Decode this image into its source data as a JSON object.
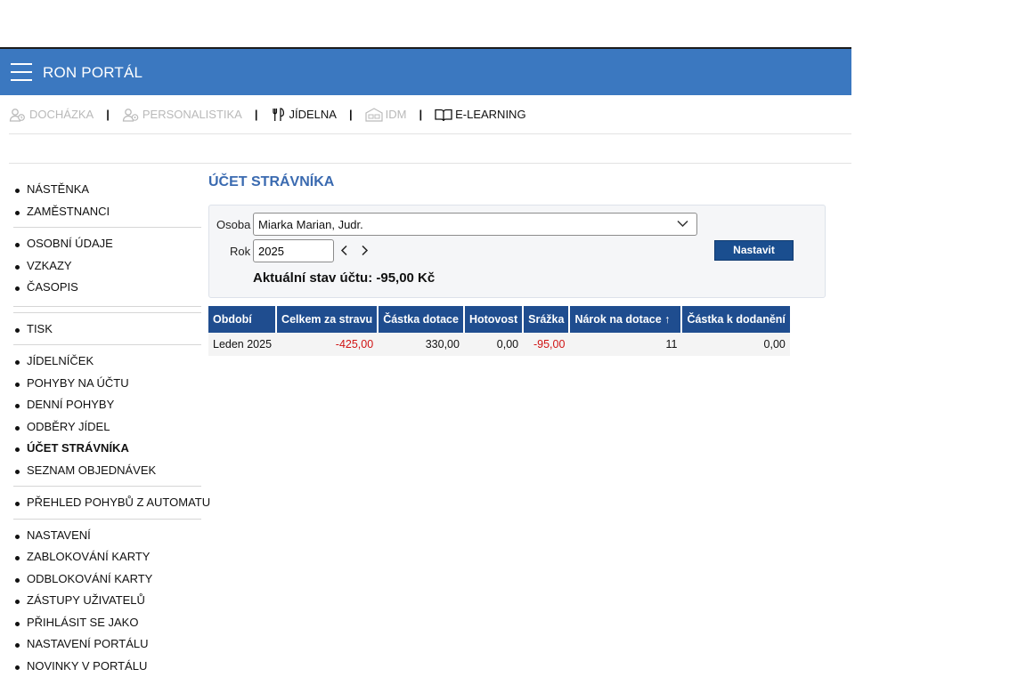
{
  "app": {
    "title": "RON PORTÁL"
  },
  "modules": [
    {
      "label": "DOCHÁZKA"
    },
    {
      "label": "PERSONALISTIKA"
    },
    {
      "label": "JÍDELNA"
    },
    {
      "label": "IDM"
    },
    {
      "label": "E-LEARNING"
    }
  ],
  "sidebar": {
    "nastenka": "NÁSTĚNKA",
    "zamestnanci": "ZAMĚSTNANCI",
    "osobni_udaje": "OSOBNÍ ÚDAJE",
    "vzkazy": "VZKAZY",
    "casopis": "ČASOPIS",
    "tisk": "TISK",
    "jidelnicek": "JÍDELNÍČEK",
    "pohyby_na_uctu": "POHYBY NA ÚČTU",
    "denni_pohyby": "DENNÍ POHYBY",
    "odbery_jidel": "ODBĚRY JÍDEL",
    "ucet_stravnika": "ÚČET STRÁVNÍKA",
    "seznam_objednavek": "SEZNAM OBJEDNÁVEK",
    "prehled_pohybu": "PŘEHLED POHYBŮ Z AUTOMATU",
    "nastaveni": "NASTAVENÍ",
    "zablokovani_karty": "ZABLOKOVÁNÍ KARTY",
    "odblokovani_karty": "ODBLOKOVÁNÍ KARTY",
    "zastupy_uzivatelu": "ZÁSTUPY UŽIVATELŮ",
    "prihlasit_se_jako": "PŘIHLÁSIT SE JAKO",
    "nastaveni_portalu": "NASTAVENÍ PORTÁLU",
    "novinky_v_portalu": "NOVINKY V PORTÁLU"
  },
  "main": {
    "title": "ÚČET STRÁVNÍKA",
    "filter": {
      "person_label": "Osoba",
      "person_value": "Miarka Marian, Judr.",
      "year_label": "Rok",
      "year_value": "2025",
      "submit_label": "Nastavit",
      "balance": "Aktuální stav účtu: -95,00 Kč"
    },
    "table": {
      "headers": {
        "obdobi": "Období",
        "celkem": "Celkem za stravu",
        "dotace": "Částka dotace",
        "hotovost": "Hotovost",
        "srazka": "Srážka",
        "narok": "Nárok na dotace ↑",
        "k_dodaneni": "Částka k dodanění"
      },
      "rows": [
        {
          "obdobi": "Leden 2025",
          "celkem": "-425,00",
          "dotace": "330,00",
          "hotovost": "0,00",
          "srazka": "-95,00",
          "narok": "11",
          "k_dodaneni": "0,00"
        }
      ]
    }
  },
  "colors": {
    "header_bar": "#3b78c0",
    "table_header": "#1f4d8f",
    "title": "#3a6ab0",
    "negative": "#d01414",
    "button": "#1a4e8f"
  }
}
